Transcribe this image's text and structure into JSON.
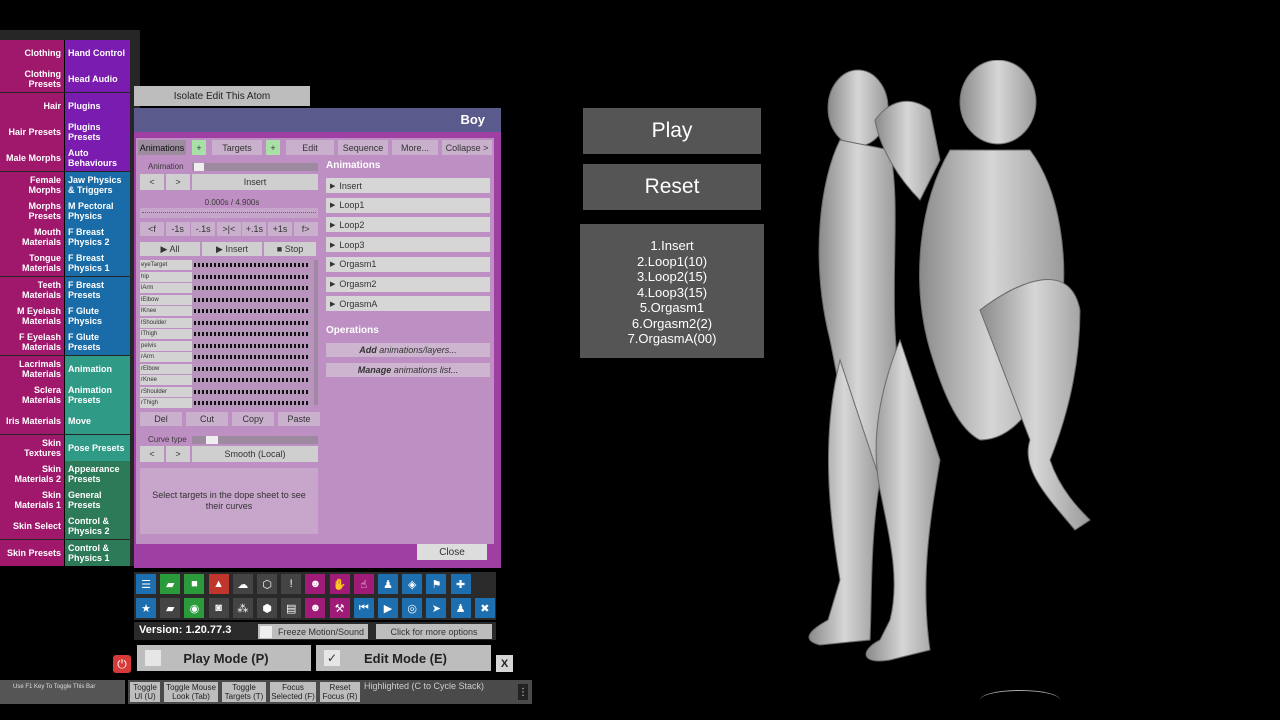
{
  "left_menu": [
    {
      "left": "Clothing",
      "right": "Hand Control",
      "color": "#7a1cb0"
    },
    {
      "left": "Clothing Presets",
      "right": "Head Audio",
      "color": "#7a1cb0"
    },
    {
      "left": "Hair",
      "right": "Plugins",
      "color": "#7a1cb0"
    },
    {
      "left": "Hair Presets",
      "right": "Plugins Presets",
      "color": "#7a1cb0"
    },
    {
      "left": "Male Morphs",
      "right": "Auto Behaviours",
      "color": "#7a1cb0"
    },
    {
      "left": "Female Morphs",
      "right": "Jaw Physics & Triggers",
      "color": "#1a6ca8"
    },
    {
      "left": "Morphs Presets",
      "right": "M Pectoral Physics",
      "color": "#1a6ca8"
    },
    {
      "left": "Mouth Materials",
      "right": "F Breast Physics 2",
      "color": "#1a6ca8"
    },
    {
      "left": "Tongue Materials",
      "right": "F Breast Physics 1",
      "color": "#1a6ca8"
    },
    {
      "left": "Teeth Materials",
      "right": "F Breast Presets",
      "color": "#1a6ca8"
    },
    {
      "left": "M Eyelash Materials",
      "right": "F Glute Physics",
      "color": "#1a6ca8"
    },
    {
      "left": "F Eyelash Materials",
      "right": "F Glute Presets",
      "color": "#1a6ca8"
    },
    {
      "left": "Lacrimals Materials",
      "right": "Animation",
      "color": "#2f9a86"
    },
    {
      "left": "Sclera Materials",
      "right": "Animation Presets",
      "color": "#2f9a86"
    },
    {
      "left": "Iris Materials",
      "right": "Move",
      "color": "#2f9a86"
    },
    {
      "left": "Skin Textures",
      "right": "Pose Presets",
      "color": "#2f9a86"
    },
    {
      "left": "Skin Materials 2",
      "right": "Appearance Presets",
      "color": "#2c7a58"
    },
    {
      "left": "Skin Materials 1",
      "right": "General Presets",
      "color": "#2c7a58"
    },
    {
      "left": "Skin Select",
      "right": "Control & Physics 2",
      "color": "#2c7a58"
    },
    {
      "left": "Skin Presets",
      "right": "Control & Physics 1",
      "color": "#2c7a58"
    }
  ],
  "isolate_button": "Isolate Edit This Atom",
  "panel": {
    "title": "Boy",
    "tabs": [
      "Animations",
      "+",
      "Targets",
      "+",
      "Edit",
      "Sequence",
      "More...",
      "Collapse >"
    ],
    "animation_label": "Animation",
    "prev": "<",
    "next": ">",
    "current_animation": "Insert",
    "time_display": "0.000s / 4.900s",
    "transport": [
      "<f",
      "-1s",
      "-.1s",
      ">|<",
      "+.1s",
      "+1s",
      "f>"
    ],
    "play_all": "▶ All",
    "play_insert": "▶ Insert",
    "stop": "■ Stop",
    "dope_targets": [
      "eyeTarget",
      "hip",
      "lArm",
      "lElbow",
      "lKnee",
      "lShoulder",
      "lThigh",
      "pelvis",
      "rArm",
      "rElbow",
      "rKnee",
      "rShoulder",
      "rThigh"
    ],
    "edit_buttons": [
      "Del",
      "Cut",
      "Copy",
      "Paste"
    ],
    "curve_type_label": "Curve type",
    "curve_type_value": "Smooth (Local)",
    "hint": "Select targets in the dope sheet to see their curves",
    "animations_header": "Animations",
    "animations": [
      "Insert",
      "Loop1",
      "Loop2",
      "Loop3",
      "Orgasm1",
      "Orgasm2",
      "OrgasmA"
    ],
    "operations_header": "Operations",
    "operations": [
      {
        "bold": "Add",
        "rest": " animations/layers..."
      },
      {
        "bold": "Manage",
        "rest": " animations list..."
      }
    ],
    "close": "Close"
  },
  "toolbar": {
    "row1": [
      {
        "icon": "menu-icon",
        "glyph": "☰",
        "color": "#1e6fb0"
      },
      {
        "icon": "open-scene-icon",
        "glyph": "▰",
        "color": "#2a9a3a"
      },
      {
        "icon": "folder-icon",
        "glyph": "■",
        "color": "#2a9a3a"
      },
      {
        "icon": "load-look-icon",
        "glyph": "▲",
        "color": "#c0352c"
      },
      {
        "icon": "cloud-icon",
        "glyph": "☁",
        "color": "#444"
      },
      {
        "icon": "cube-icon",
        "glyph": "⬡",
        "color": "#444"
      },
      {
        "icon": "alert-icon",
        "glyph": "!",
        "color": "#444"
      },
      {
        "icon": "person-add-icon",
        "glyph": "☻",
        "color": "#a01b78"
      },
      {
        "icon": "hand-icon",
        "glyph": "✋",
        "color": "#a01b78"
      },
      {
        "icon": "hand-point-icon",
        "glyph": "☝",
        "color": "#a01b78"
      },
      {
        "icon": "person-icon",
        "glyph": "♟",
        "color": "#1e6fb0"
      },
      {
        "icon": "unity-icon",
        "glyph": "◈",
        "color": "#1e6fb0"
      },
      {
        "icon": "flag-icon",
        "glyph": "⚑",
        "color": "#1e6fb0"
      },
      {
        "icon": "add-icon",
        "glyph": "✚",
        "color": "#1e6fb0"
      }
    ],
    "row2": [
      {
        "icon": "star-icon",
        "glyph": "★",
        "color": "#1e6fb0"
      },
      {
        "icon": "save-scene-icon",
        "glyph": "▰",
        "color": "#444"
      },
      {
        "icon": "camera-icon",
        "glyph": "◉",
        "color": "#2a9a3a"
      },
      {
        "icon": "screenshot-icon",
        "glyph": "◙",
        "color": "#444"
      },
      {
        "icon": "network-icon",
        "glyph": "⁂",
        "color": "#444"
      },
      {
        "icon": "package-icon",
        "glyph": "⬢",
        "color": "#444"
      },
      {
        "icon": "document-icon",
        "glyph": "▤",
        "color": "#444"
      },
      {
        "icon": "person-edit-icon",
        "glyph": "☻",
        "color": "#a01b78"
      },
      {
        "icon": "hammer-icon",
        "glyph": "⚒",
        "color": "#a01b78"
      },
      {
        "icon": "skip-back-icon",
        "glyph": "⏮",
        "color": "#1e6fb0"
      },
      {
        "icon": "play-icon",
        "glyph": "▶",
        "color": "#1e6fb0"
      },
      {
        "icon": "target-icon",
        "glyph": "◎",
        "color": "#1e6fb0"
      },
      {
        "icon": "cursor-icon",
        "glyph": "➤",
        "color": "#1e6fb0"
      },
      {
        "icon": "people-icon",
        "glyph": "♟",
        "color": "#1e6fb0"
      },
      {
        "icon": "tools-icon",
        "glyph": "✖",
        "color": "#1e6fb0"
      }
    ]
  },
  "version": "Version: 1.20.77.3",
  "freeze_motion": "Freeze Motion/Sound",
  "more_options": "Click for more options",
  "play_mode": "Play Mode (P)",
  "edit_mode": "Edit Mode (E)",
  "edit_check": "✓",
  "close_x": "X",
  "f1_hint": "Use F1 Key To Toggle This Bar",
  "bottom_buttons": [
    "Toggle UI (U)",
    "Toggle Mouse Look (Tab)",
    "Toggle Targets (T)",
    "Focus Selected (F)",
    "Reset Focus (R)"
  ],
  "highlight_hint": "Highlighted (C to Cycle Stack)",
  "play_button": "Play",
  "reset_button": "Reset",
  "sequence": [
    "1.Insert",
    "2.Loop1(10)",
    "3.Loop2(15)",
    "4.Loop3(15)",
    "5.Orgasm1",
    "6.Orgasm2(2)",
    "7.OrgasmA(00)"
  ]
}
